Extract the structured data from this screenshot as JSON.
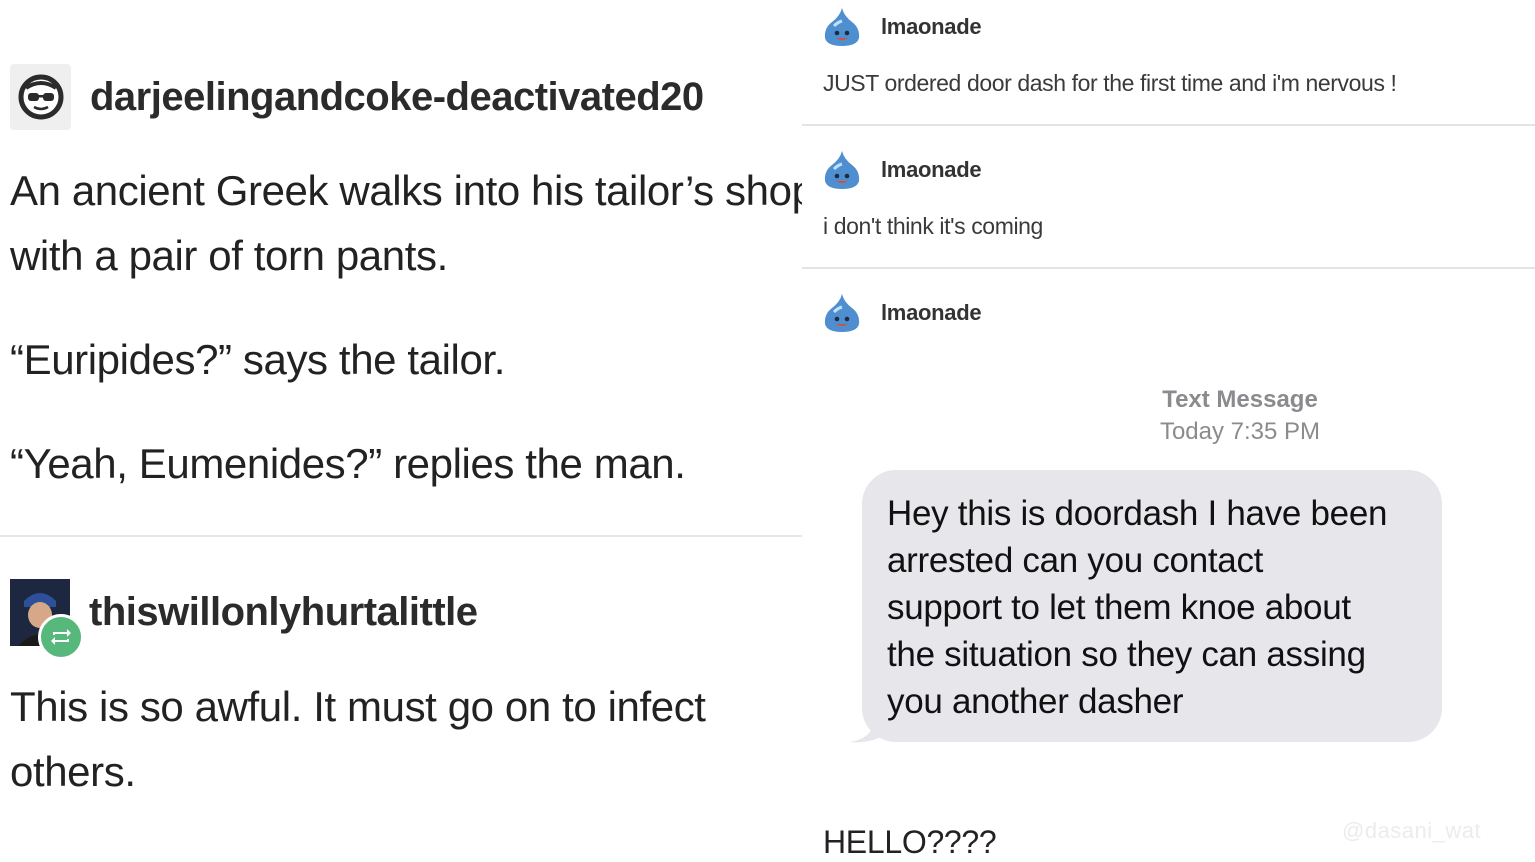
{
  "left_panel": {
    "post1": {
      "username": "darjeelingandcoke-deactivated20",
      "avatar_icon": "sunglasses-face-icon",
      "lines": [
        "An ancient Greek walks into his tailor’s shop",
        "with a pair of torn pants.",
        "“Euripides?” says the tailor.",
        "“Yeah, Eumenides?” replies the man."
      ]
    },
    "post2": {
      "username": "thiswillonlyhurtalittle",
      "avatar_icon": "user-photo-avatar",
      "badge_icon": "reblog-icon",
      "badge_color": "#56b87a",
      "lines": [
        "This is so awful. It must go on to infect",
        "others."
      ]
    }
  },
  "right_panel": {
    "messages": [
      {
        "user": "lmaonade",
        "avatar_icon": "blue-slime-icon",
        "text": "JUST ordered door dash for the first time and i'm nervous !"
      },
      {
        "user": "lmaonade",
        "avatar_icon": "blue-slime-icon",
        "text": "i don't think it's coming"
      },
      {
        "user": "lmaonade",
        "avatar_icon": "blue-slime-icon"
      }
    ],
    "sms": {
      "label": "Text Message",
      "timestamp": "Today 7:35 PM",
      "bubble_lines": [
        "Hey this is doordash I have been",
        "arrested can you contact",
        "support to let them knoe about",
        "the situation so they can assing",
        "you another dasher"
      ],
      "bubble_color": "#e6e6eb"
    },
    "footer_text": "HELLO????",
    "watermark": "@dasani_wat"
  }
}
